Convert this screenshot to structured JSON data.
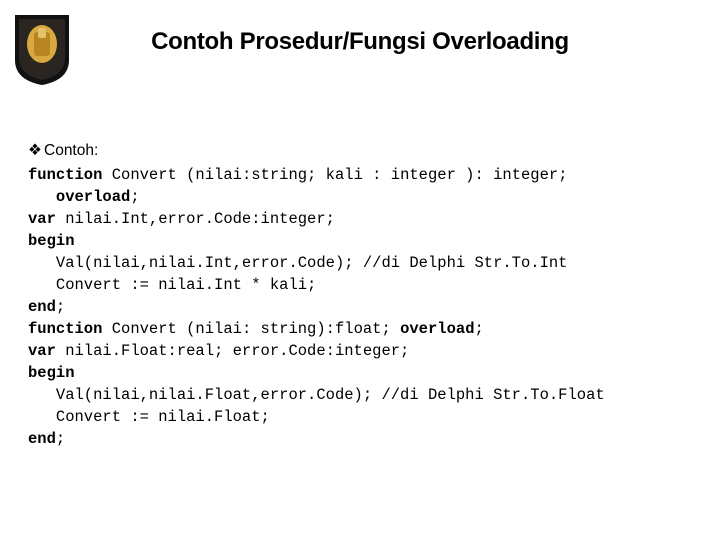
{
  "title": "Contoh Prosedur/Fungsi Overloading",
  "bullet_glyph": "❖",
  "bullet_label": "Contoh:",
  "code": {
    "l1a": "function",
    "l1b": " Convert (nilai:string; kali : integer ): integer;",
    "l2a": "   overload",
    "l2b": ";",
    "l3a": "var",
    "l3b": " nilai.Int,error.Code:integer;",
    "l4": "begin",
    "l5": "   Val(nilai,nilai.Int,error.Code); //di Delphi Str.To.Int",
    "l6": "   Convert := nilai.Int * kali;",
    "l7a": "end",
    "l7b": ";",
    "l8a": "function",
    "l8b": " Convert (nilai: string):float; ",
    "l8c": "overload",
    "l8d": ";",
    "l9a": "var",
    "l9b": " nilai.Float:real; error.Code:integer;",
    "l10": "begin",
    "l11": "   Val(nilai,nilai.Float,error.Code); //di Delphi Str.To.Float",
    "l12": "   Convert := nilai.Float;",
    "l13a": "end",
    "l13b": ";"
  }
}
